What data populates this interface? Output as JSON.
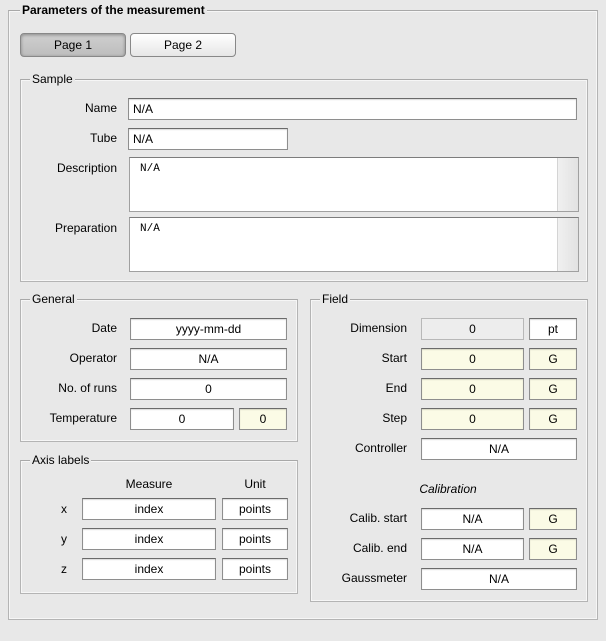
{
  "main": {
    "title": "Parameters of the measurement"
  },
  "tabs": [
    {
      "label": "Page 1"
    },
    {
      "label": "Page 2"
    }
  ],
  "sample": {
    "title": "Sample",
    "name_label": "Name",
    "name_value": "N/A",
    "tube_label": "Tube",
    "tube_value": "N/A",
    "description_label": "Description",
    "description_value": "N/A",
    "preparation_label": "Preparation",
    "preparation_value": "N/A"
  },
  "general": {
    "title": "General",
    "date_label": "Date",
    "date_value": "yyyy-mm-dd",
    "operator_label": "Operator",
    "operator_value": "N/A",
    "runs_label": "No. of runs",
    "runs_value": "0",
    "temperature_label": "Temperature",
    "temperature_value": "0",
    "temperature_unit": "0"
  },
  "axis_labels": {
    "title": "Axis labels",
    "measure_header": "Measure",
    "unit_header": "Unit",
    "rows": [
      {
        "axis": "x",
        "measure": "index",
        "unit": "points"
      },
      {
        "axis": "y",
        "measure": "index",
        "unit": "points"
      },
      {
        "axis": "z",
        "measure": "index",
        "unit": "points"
      }
    ]
  },
  "field": {
    "title": "Field",
    "dimension_label": "Dimension",
    "dimension_value": "0",
    "dimension_unit": "pt",
    "start_label": "Start",
    "start_value": "0",
    "start_unit": "G",
    "end_label": "End",
    "end_value": "0",
    "end_unit": "G",
    "step_label": "Step",
    "step_value": "0",
    "step_unit": "G",
    "controller_label": "Controller",
    "controller_value": "N/A",
    "calibration_title": "Calibration",
    "calib_start_label": "Calib. start",
    "calib_start_value": "N/A",
    "calib_start_unit": "G",
    "calib_end_label": "Calib. end",
    "calib_end_value": "N/A",
    "calib_end_unit": "G",
    "gaussmeter_label": "Gaussmeter",
    "gaussmeter_value": "N/A"
  }
}
